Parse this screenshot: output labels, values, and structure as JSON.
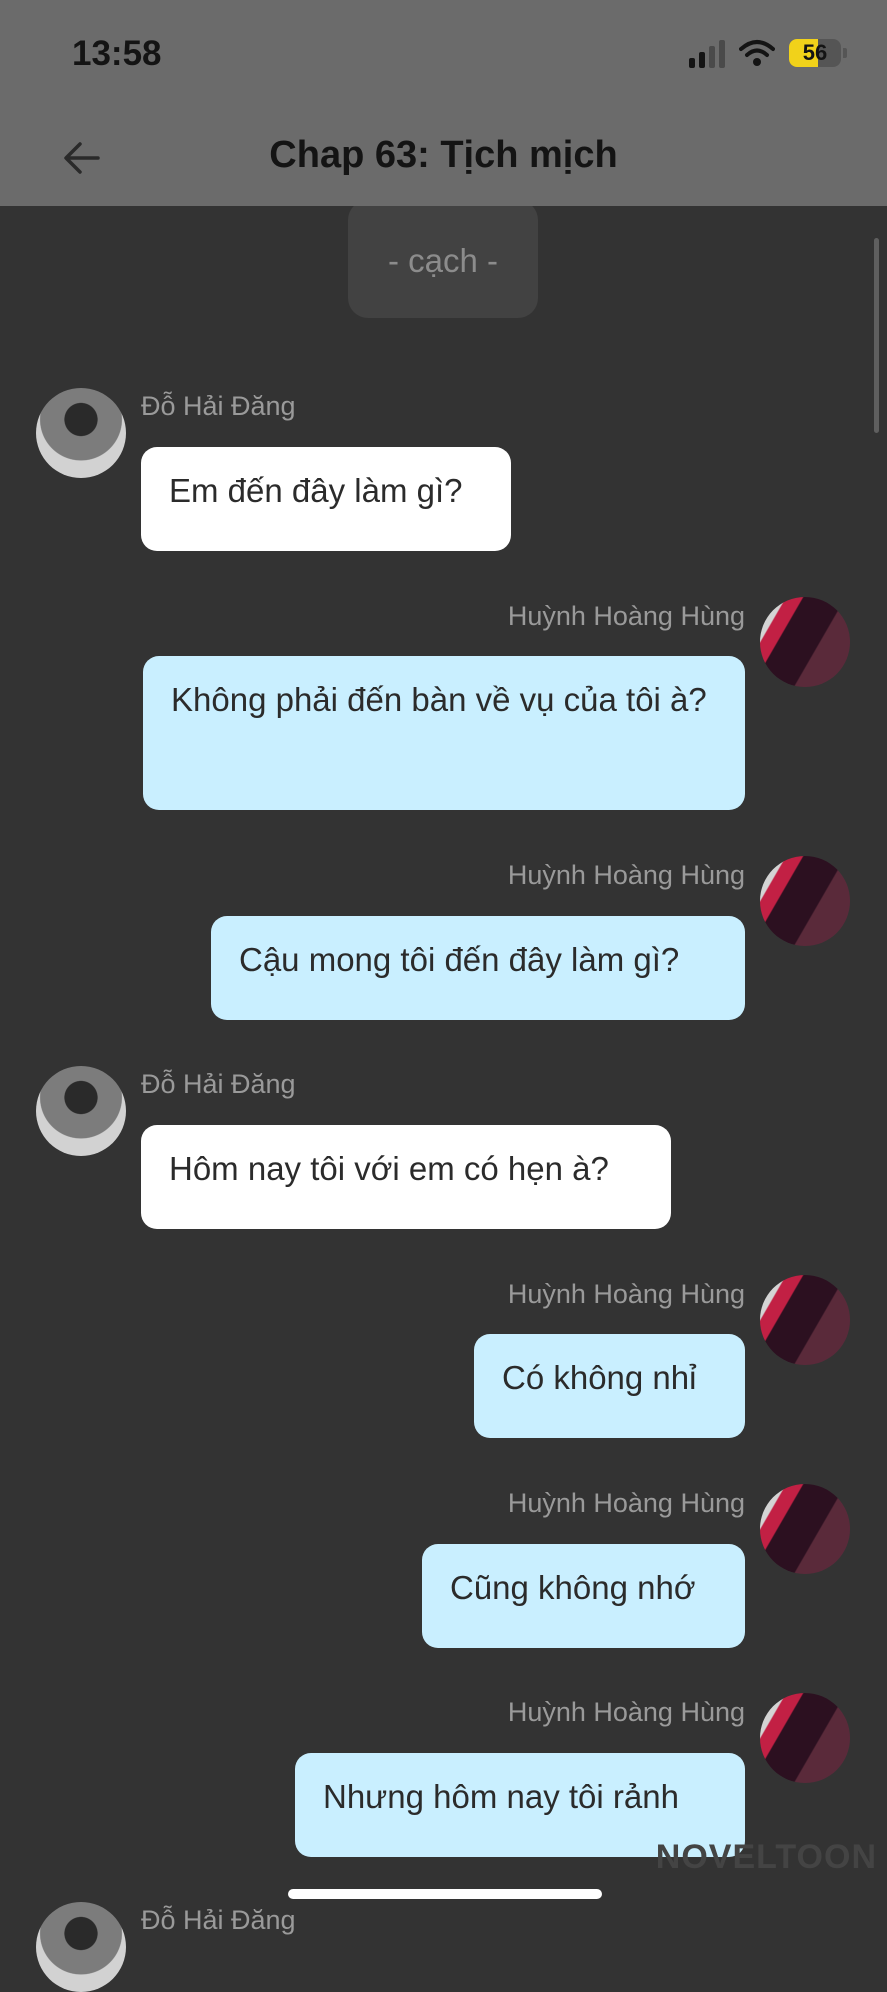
{
  "status_bar": {
    "time": "13:58",
    "battery": "56"
  },
  "header": {
    "title": "Chap 63: Tịch mịch"
  },
  "narration": "- cạch -",
  "messages": [
    {
      "speaker": "Đỗ Hải Đăng",
      "text": "Em đến đây làm gì?"
    },
    {
      "speaker": "Huỳnh Hoàng Hùng",
      "text": "Không phải đến bàn về vụ của tôi à?"
    },
    {
      "speaker": "Huỳnh Hoàng Hùng",
      "text": "Cậu mong tôi đến đây làm gì?"
    },
    {
      "speaker": "Đỗ Hải Đăng",
      "text": "Hôm nay tôi với em có hẹn à?"
    },
    {
      "speaker": "Huỳnh Hoàng Hùng",
      "text": "Có không nhỉ"
    },
    {
      "speaker": "Huỳnh Hoàng Hùng",
      "text": "Cũng không nhớ"
    },
    {
      "speaker": "Huỳnh Hoàng Hùng",
      "text": "Nhưng hôm nay tôi rảnh"
    },
    {
      "speaker": "Đỗ Hải Đăng"
    }
  ],
  "watermark": "NOVELTOON",
  "icons": {
    "back": "arrow-left-icon",
    "signal": "cellular-signal-icon",
    "wifi": "wifi-icon",
    "battery": "battery-icon"
  },
  "colors": {
    "background": "#333333",
    "incoming_bubble": "#ffffff",
    "outgoing_bubble": "#c9efff",
    "battery_fill": "#f1d21a"
  }
}
